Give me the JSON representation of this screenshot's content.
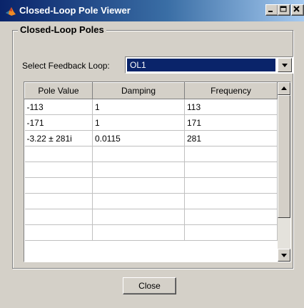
{
  "window": {
    "title": "Closed-Loop Pole Viewer"
  },
  "group": {
    "label": "Closed-Loop Poles"
  },
  "feedback": {
    "label": "Select Feedback Loop:",
    "selected": "OL1"
  },
  "table": {
    "columns": [
      "Pole Value",
      "Damping",
      "Frequency"
    ],
    "rows": [
      [
        "-113",
        "1",
        "113"
      ],
      [
        "-171",
        "1",
        "171"
      ],
      [
        "-3.22 ± 281i",
        "0.0115",
        "281"
      ]
    ],
    "empty_rows": 6
  },
  "buttons": {
    "close": "Close"
  },
  "colors": {
    "title_start": "#0a246a",
    "title_end": "#a6caf0",
    "selection": "#0a246a",
    "face": "#d4d0c8"
  }
}
